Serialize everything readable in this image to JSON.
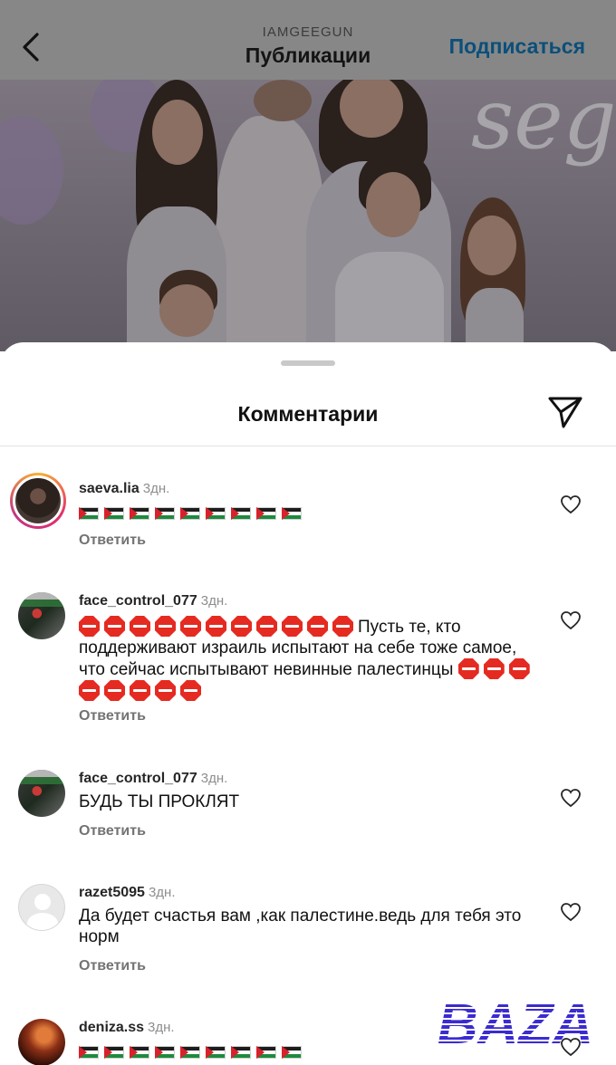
{
  "header": {
    "subtitle": "IAMGEEGUN",
    "title": "Публикации",
    "follow_label": "Подписаться",
    "back_icon": "chevron-left-icon"
  },
  "photo": {
    "decor_text": "segu"
  },
  "sheet": {
    "title": "Комментарии",
    "share_icon": "paper-plane-icon"
  },
  "comments": [
    {
      "username": "saeva.lia",
      "time": "3дн.",
      "text": "🇵🇸🇵🇸🇵🇸🇵🇸🇵🇸🇵🇸🇵🇸🇵🇸🇵🇸",
      "flag_count": 9,
      "reply_label": "Ответить"
    },
    {
      "username": "face_control_077",
      "time": "3дн.",
      "text_before": "🛑🛑🛑🛑🛑🛑🛑🛑🛑🛑🛑",
      "text_main": "Пусть те, кто поддерживают израиль испытают на себе тоже самое, что сейчас испытывают невинные палестинцы",
      "text_after": "🛑🛑🛑🛑🛑🛑🛑🛑",
      "reply_label": "Ответить"
    },
    {
      "username": "face_control_077",
      "time": "3дн.",
      "text": "БУДЬ ТЫ ПРОКЛЯТ",
      "reply_label": "Ответить"
    },
    {
      "username": "razet5095",
      "time": "3дн.",
      "text": "Да будет счастья вам ,как палестине.ведь для тебя это норм",
      "reply_label": "Ответить"
    },
    {
      "username": "deniza.ss",
      "time": "3дн.",
      "text": "🇵🇸🇵🇸🇵🇸🇵🇸🇵🇸🇵🇸🇵🇸🇵🇸🇵🇸",
      "flag_count": 9
    }
  ],
  "watermark": {
    "text": "BAZA",
    "color": "#3b2bd1"
  },
  "colors": {
    "follow": "#0b4f7a",
    "stop_sign": "#e52a21",
    "palestine_green": "#1d8a3d",
    "palestine_red": "#d8212b"
  }
}
